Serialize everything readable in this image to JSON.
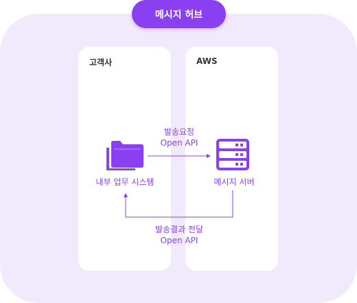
{
  "hub": {
    "title": "메시지 허브"
  },
  "panels": {
    "customer": {
      "title": "고객사"
    },
    "aws": {
      "title": "AWS"
    }
  },
  "nodes": {
    "internal_system": {
      "label": "내부 업무 시스템",
      "icon": "folder-icon"
    },
    "message_server": {
      "label": "메시지 서버",
      "icon": "server-icon"
    }
  },
  "flows": {
    "send_request": {
      "line1": "발송요청",
      "line2": "Open API"
    },
    "send_result": {
      "line1": "발송결과 전달",
      "line2": "Open API"
    }
  },
  "colors": {
    "accent": "#8a3ff0",
    "background": "#f1eafd",
    "panel": "#ffffff"
  }
}
